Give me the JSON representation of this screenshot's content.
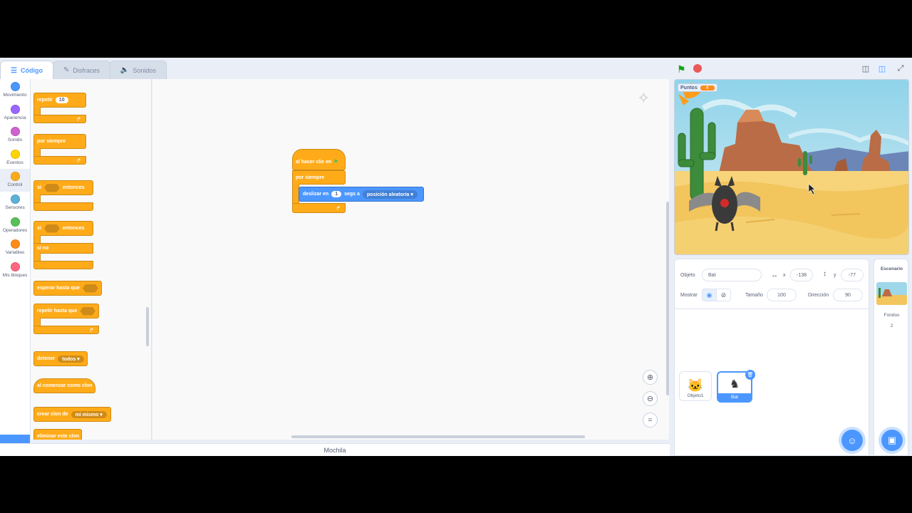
{
  "tabs": [
    {
      "label": "Código",
      "icon": "code-icon"
    },
    {
      "label": "Disfraces",
      "icon": "brush-icon"
    },
    {
      "label": "Sonidos",
      "icon": "speaker-icon"
    }
  ],
  "categories": [
    {
      "label": "Movimiento",
      "color": "#4c97ff"
    },
    {
      "label": "Apariencia",
      "color": "#9966ff"
    },
    {
      "label": "Sonido",
      "color": "#cf63cf"
    },
    {
      "label": "Eventos",
      "color": "#ffd500"
    },
    {
      "label": "Control",
      "color": "#ffab19"
    },
    {
      "label": "Sensores",
      "color": "#5cb1d6"
    },
    {
      "label": "Operadores",
      "color": "#59c059"
    },
    {
      "label": "Variables",
      "color": "#ff8c1a"
    },
    {
      "label": "Mis bloques",
      "color": "#ff6680"
    }
  ],
  "palette": {
    "repeat": "repetir",
    "repeat_count": "10",
    "forever": "por siempre",
    "if": "si",
    "then": "entonces",
    "else": "si no",
    "wait_until": "esperar hasta que",
    "repeat_until": "repetir hasta que",
    "stop": "detener",
    "stop_option": "todos",
    "clone_start": "al comenzar como clon",
    "create_clone": "crear clon de",
    "clone_option": "mi mismo",
    "delete_clone": "eliminar este clon"
  },
  "script": {
    "hat": "al hacer clic en",
    "forever": "por siempre",
    "glide": "deslizar en",
    "glide_secs": "1",
    "glide_mid": "segs a",
    "glide_target": "posición aleatoria"
  },
  "backpack": "Mochila",
  "monitor": {
    "label": "Puntos",
    "value": "4"
  },
  "sprite_info": {
    "object_label": "Objeto",
    "object_name": "Bat",
    "x_label": "x",
    "x_value": "-138",
    "y_label": "y",
    "y_value": "-77",
    "show_label": "Mostrar",
    "size_label": "Tamaño",
    "size_value": "100",
    "direction_label": "Dirección",
    "direction_value": "90"
  },
  "sprites": [
    {
      "name": "Objeto1",
      "icon": "cat-sprite-icon"
    },
    {
      "name": "Bat",
      "icon": "bat-sprite-icon"
    }
  ],
  "backdrop": {
    "title": "Escenario",
    "label": "Fondos",
    "count": "2"
  },
  "colors": {
    "accent": "#4c97ff",
    "control": "#ffab19",
    "motion": "#4c97ff"
  }
}
